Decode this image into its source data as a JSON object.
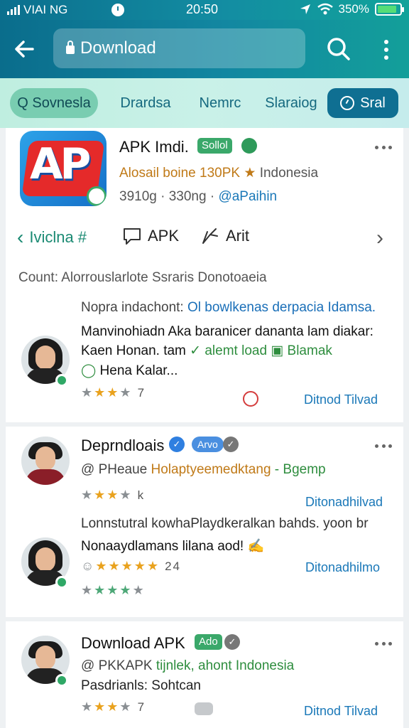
{
  "status_bar": {
    "carrier": "VIAI NG",
    "time": "20:50",
    "battery": "350%"
  },
  "search": {
    "value": "Download"
  },
  "tabs": [
    {
      "label": "Q Sovnesla"
    },
    {
      "label": "Drardsa"
    },
    {
      "label": "Nemrc"
    },
    {
      "label": "Slaraiog"
    },
    {
      "label": "Sral"
    }
  ],
  "app": {
    "logo_text": "AP",
    "title": "APK Imdi.",
    "badge": "Sollol",
    "meta1": {
      "orange": "Alosail boine 130PK",
      "star": "★",
      "gray": "Indonesia"
    },
    "meta2": {
      "gray": "3910g · 330ng ·",
      "blue": "@aPaihin"
    }
  },
  "actions": {
    "first": "Iviclna #",
    "second": "APK",
    "third": "Arit"
  },
  "counts": "Count: Alorrouslarlote Ssraris Donotoaeia",
  "review_heading": {
    "gray": "Nopra indachont:",
    "blue": "Ol bowlkenas derpacia Idamsa."
  },
  "review1": {
    "line1": "Manvinohiadn Aka baranicer dananta lam diakar:",
    "line2_a": "Kaen Honan. tam",
    "line2_b": "✓ alemt load",
    "line2_c": "▣ Blamak",
    "line3": "Hena Kalar...",
    "rating": "7",
    "link": "Ditnod Tilvad"
  },
  "card2": {
    "name": "Deprndloais",
    "pill": "Arvo",
    "handle_gray": "@ PHeaue",
    "handle_orange": "Holaptyeemedktang",
    "handle_green": "- Bgemp",
    "rating1": "k",
    "link1": "Ditonadhilvad",
    "text1": "Lonnstutral kowhaPlaydkeralkan bahds. yoon br",
    "text2": "Nonaaydlamans lilana aod!",
    "rating2": "24",
    "link2": "Ditonadhilmo"
  },
  "card3": {
    "name": "Download APK",
    "pill": "Ado",
    "line1_gray": "@ PKKAPK",
    "line1_green": "tijnlek, ahont Indonesia",
    "line2": "Pasdrianls: Sohtcan",
    "rating": "7",
    "link": "Ditnod Tilvad"
  }
}
